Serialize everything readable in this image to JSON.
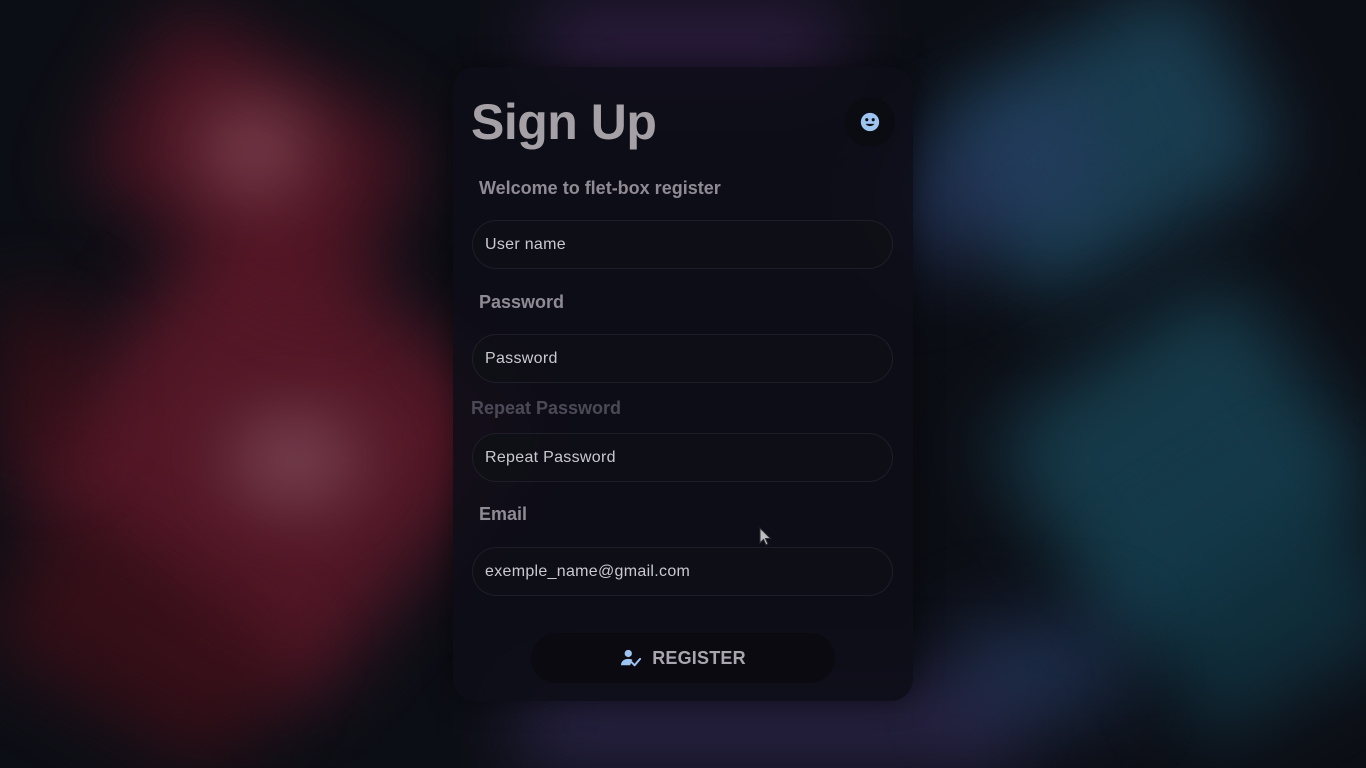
{
  "header": {
    "title": "Sign Up",
    "theme_toggle_icon": "emoji-face-icon"
  },
  "form": {
    "welcome_label": "Welcome to flet-box register",
    "username": {
      "placeholder": "User name",
      "value": ""
    },
    "password_label": "Password",
    "password": {
      "placeholder": "Password",
      "value": ""
    },
    "repeat_password_label": "Repeat Password",
    "repeat_password": {
      "placeholder": "Repeat Password",
      "value": ""
    },
    "email_label": "Email",
    "email": {
      "placeholder": "exemple_name@gmail.com",
      "value": ""
    },
    "register_button": {
      "label": "REGISTER",
      "icon": "person-check-icon"
    }
  },
  "colors": {
    "accent_icon": "#9ec4f2",
    "card_bg": "#0e0e18",
    "label_text": "#8f8a93",
    "title_text": "#a5a0a6"
  }
}
